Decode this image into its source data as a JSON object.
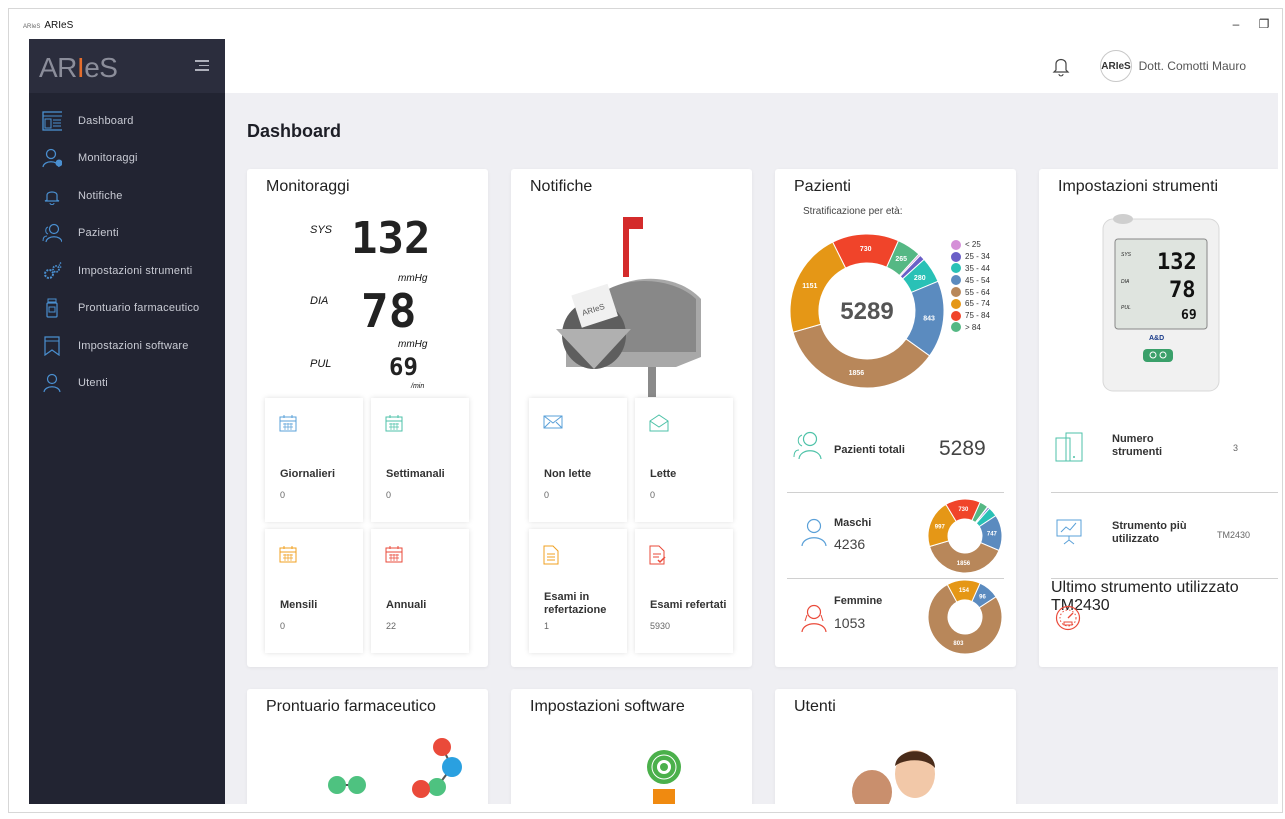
{
  "app": {
    "small_logo": "ARIeS",
    "title": "ARIeS",
    "minimize": "–",
    "restore": "❐"
  },
  "sidebar": {
    "logo_pre": "AR",
    "logo_i": "I",
    "logo_post": "eS",
    "items": [
      {
        "label": "Dashboard",
        "icon": "dashboard-icon"
      },
      {
        "label": "Monitoraggi",
        "icon": "user-monitor-icon"
      },
      {
        "label": "Notifiche",
        "icon": "bell-icon"
      },
      {
        "label": "Pazienti",
        "icon": "patients-icon"
      },
      {
        "label": "Impostazioni strumenti",
        "icon": "gears-icon"
      },
      {
        "label": "Prontuario farmaceutico",
        "icon": "pill-bottle-icon"
      },
      {
        "label": "Impostazioni software",
        "icon": "bookmark-icon"
      },
      {
        "label": "Utenti",
        "icon": "user-icon"
      }
    ]
  },
  "header": {
    "avatar_text": "ARIeS",
    "user_name": "Dott. Comotti Mauro"
  },
  "page": {
    "title": "Dashboard"
  },
  "monitoraggi": {
    "title": "Monitoraggi",
    "sys_label": "SYS",
    "sys_value": "132",
    "sys_unit": "mmHg",
    "dia_label": "DIA",
    "dia_value": "78",
    "dia_unit": "mmHg",
    "pul_label": "PUL",
    "pul_value": "69",
    "pul_unit": "/min",
    "tiles": [
      {
        "label": "Giornalieri",
        "value": "0"
      },
      {
        "label": "Settimanali",
        "value": "0"
      },
      {
        "label": "Mensili",
        "value": "0"
      },
      {
        "label": "Annuali",
        "value": "22"
      }
    ]
  },
  "notifiche": {
    "title": "Notifiche",
    "mailbox_text": "ARIeS",
    "tiles": [
      {
        "label": "Non lette",
        "value": "0"
      },
      {
        "label": "Lette",
        "value": "0"
      },
      {
        "label": "Esami in refertazione",
        "value": "1"
      },
      {
        "label": "Esami refertati",
        "value": "5930"
      }
    ]
  },
  "pazienti": {
    "title": "Pazienti",
    "subtitle": "Stratificazione per età:",
    "total_center": "5289",
    "totali_label": "Pazienti totali",
    "totali_value": "5289",
    "maschi_label": "Maschi",
    "maschi_value": "4236",
    "femmine_label": "Femmine",
    "femmine_value": "1053",
    "colors": [
      "#d58fd8",
      "#6a5fc7",
      "#29c1b6",
      "#5b8bbf",
      "#b8875a",
      "#e59716",
      "#f0442a",
      "#55b884"
    ],
    "legend": [
      "< 25",
      "25 - 34",
      "35 - 44",
      "45 - 54",
      "55 - 64",
      "65 - 74",
      "75 - 84",
      "> 84"
    ]
  },
  "chart_data": [
    {
      "type": "pie",
      "title": "Stratificazione per età:",
      "categories": [
        "< 25",
        "25 - 34",
        "35 - 44",
        "45 - 54",
        "55 - 64",
        "65 - 74",
        "75 - 84",
        "> 84"
      ],
      "values": [
        20,
        60,
        280,
        843,
        1856,
        1151,
        730,
        265
      ],
      "labels": [
        "",
        "",
        "280",
        "843",
        "1856",
        "1151",
        "730",
        "265"
      ],
      "center_label": "5289"
    },
    {
      "type": "pie",
      "title": "Maschi",
      "categories": [
        "< 25",
        "25 - 34",
        "35 - 44",
        "45 - 54",
        "55 - 64",
        "65 - 74",
        "75 - 84",
        "> 84"
      ],
      "values": [
        10,
        40,
        200,
        747,
        1856,
        997,
        730,
        180
      ],
      "labels": [
        "",
        "",
        "",
        "747",
        "1856",
        "997",
        "730",
        ""
      ]
    },
    {
      "type": "pie",
      "title": "Femmine",
      "categories": [
        "< 25",
        "25 - 34",
        "35 - 44",
        "45 - 54",
        "55 - 64",
        "65 - 74",
        "75 - 84",
        "> 84"
      ],
      "values": [
        0,
        0,
        0,
        96,
        803,
        154,
        0,
        0
      ],
      "labels": [
        "",
        "",
        "",
        "96",
        "803",
        "154",
        "",
        ""
      ]
    }
  ],
  "strumenti": {
    "title": "Impostazioni strumenti",
    "device_sys": "132",
    "device_dia": "78",
    "device_pul": "69",
    "device_sys_lbl": "SYS",
    "device_dia_lbl": "DIA",
    "device_pul_lbl": "PUL",
    "device_brand": "A&D",
    "rows": [
      {
        "label": "Numero strumenti",
        "value": "3"
      },
      {
        "label": "Strumento più utilizzato",
        "value": "TM2430"
      },
      {
        "label": "Ultimo strumento utilizzato",
        "value": "TM2430"
      }
    ]
  },
  "bottom_cards": {
    "prontuario": "Prontuario farmaceutico",
    "software": "Impostazioni software",
    "utenti": "Utenti"
  }
}
